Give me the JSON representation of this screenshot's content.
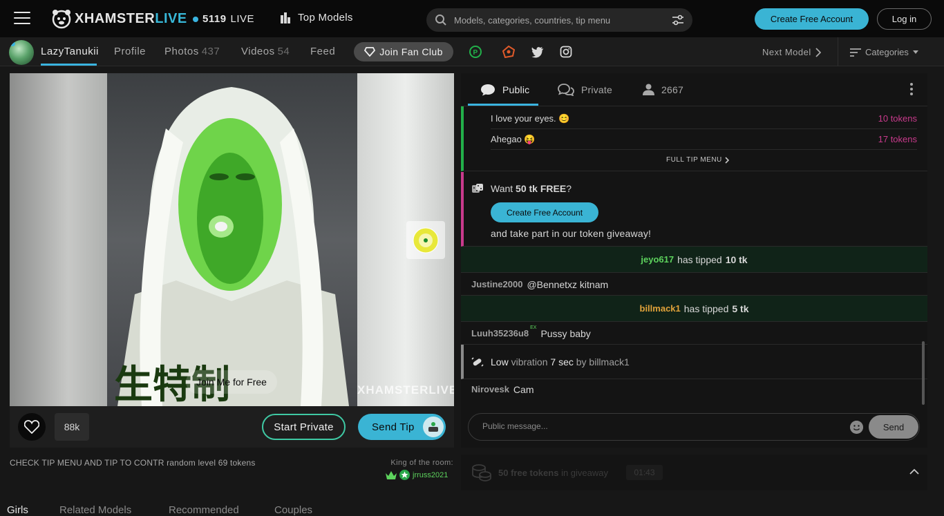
{
  "header": {
    "logo_main": "XHAMSTER",
    "logo_accent": "LIVE",
    "live_count": "5119",
    "live_label": "LIVE",
    "top_models": "Top Models",
    "search_placeholder": "Models, categories, countries, tip menu",
    "create_account": "Create Free Account",
    "login": "Log in"
  },
  "model_bar": {
    "username": "LazyTanukii",
    "profile": "Profile",
    "photos": "Photos",
    "photos_count": "437",
    "videos": "Videos",
    "videos_count": "54",
    "feed": "Feed",
    "fan_club": "Join Fan Club",
    "next_model": "Next Model",
    "categories": "Categories"
  },
  "video": {
    "watermark": "XHAMSTERLIVE",
    "join_me": "Join Me for Free"
  },
  "controls": {
    "likes": "88k",
    "start_private": "Start Private",
    "send_tip": "Send Tip"
  },
  "room": {
    "subject": "CHECK TIP MENU AND TIP TO CONTR random level 69 tokens",
    "king_label": "King of the room:",
    "king_user": "jrruss2021"
  },
  "bottom_tabs": [
    "Girls",
    "Related Models",
    "Recommended",
    "Couples"
  ],
  "chat": {
    "tab_public": "Public",
    "tab_private": "Private",
    "viewers": "2667",
    "tip_menu": [
      {
        "label": "I love your eyes. 😊",
        "price": "10 tokens"
      },
      {
        "label": "Ahegao 😝",
        "price": "17 tokens"
      }
    ],
    "full_tip_menu": "FULL TIP MENU",
    "giveaway_want": "Want",
    "giveaway_amount": "50 tk FREE",
    "giveaway_q": "?",
    "giveaway_button": "Create Free Account",
    "giveaway_after": "and take part in our token giveaway!",
    "tip1_user": "jeyo617",
    "tip1_text": "has tipped",
    "tip1_amount": "10 tk",
    "msg1_user": "Justine2000",
    "msg1_text": "@Bennetxz kitnam",
    "tip2_user": "billmack1",
    "tip2_text": "has tipped",
    "tip2_amount": "5 tk",
    "msg2_user": "Luuh35236u8",
    "msg2_badge": "EX",
    "msg2_text": "Pussy baby",
    "vibe_level": "Low",
    "vibe_word": "vibration",
    "vibe_time": "7 sec",
    "vibe_by": "by billmack1",
    "msg3_user": "Nirovesk",
    "msg3_text": "Cam",
    "input_placeholder": "Public message...",
    "send": "Send"
  },
  "free_bar": {
    "amount": "50 free tokens",
    "in": "in giveaway",
    "timer": "01:43"
  },
  "colors": {
    "accent": "#3ab4d4",
    "tip_price": "#c93a8c",
    "green_user": "#5dd35d",
    "gold_user": "#e0a23a"
  }
}
